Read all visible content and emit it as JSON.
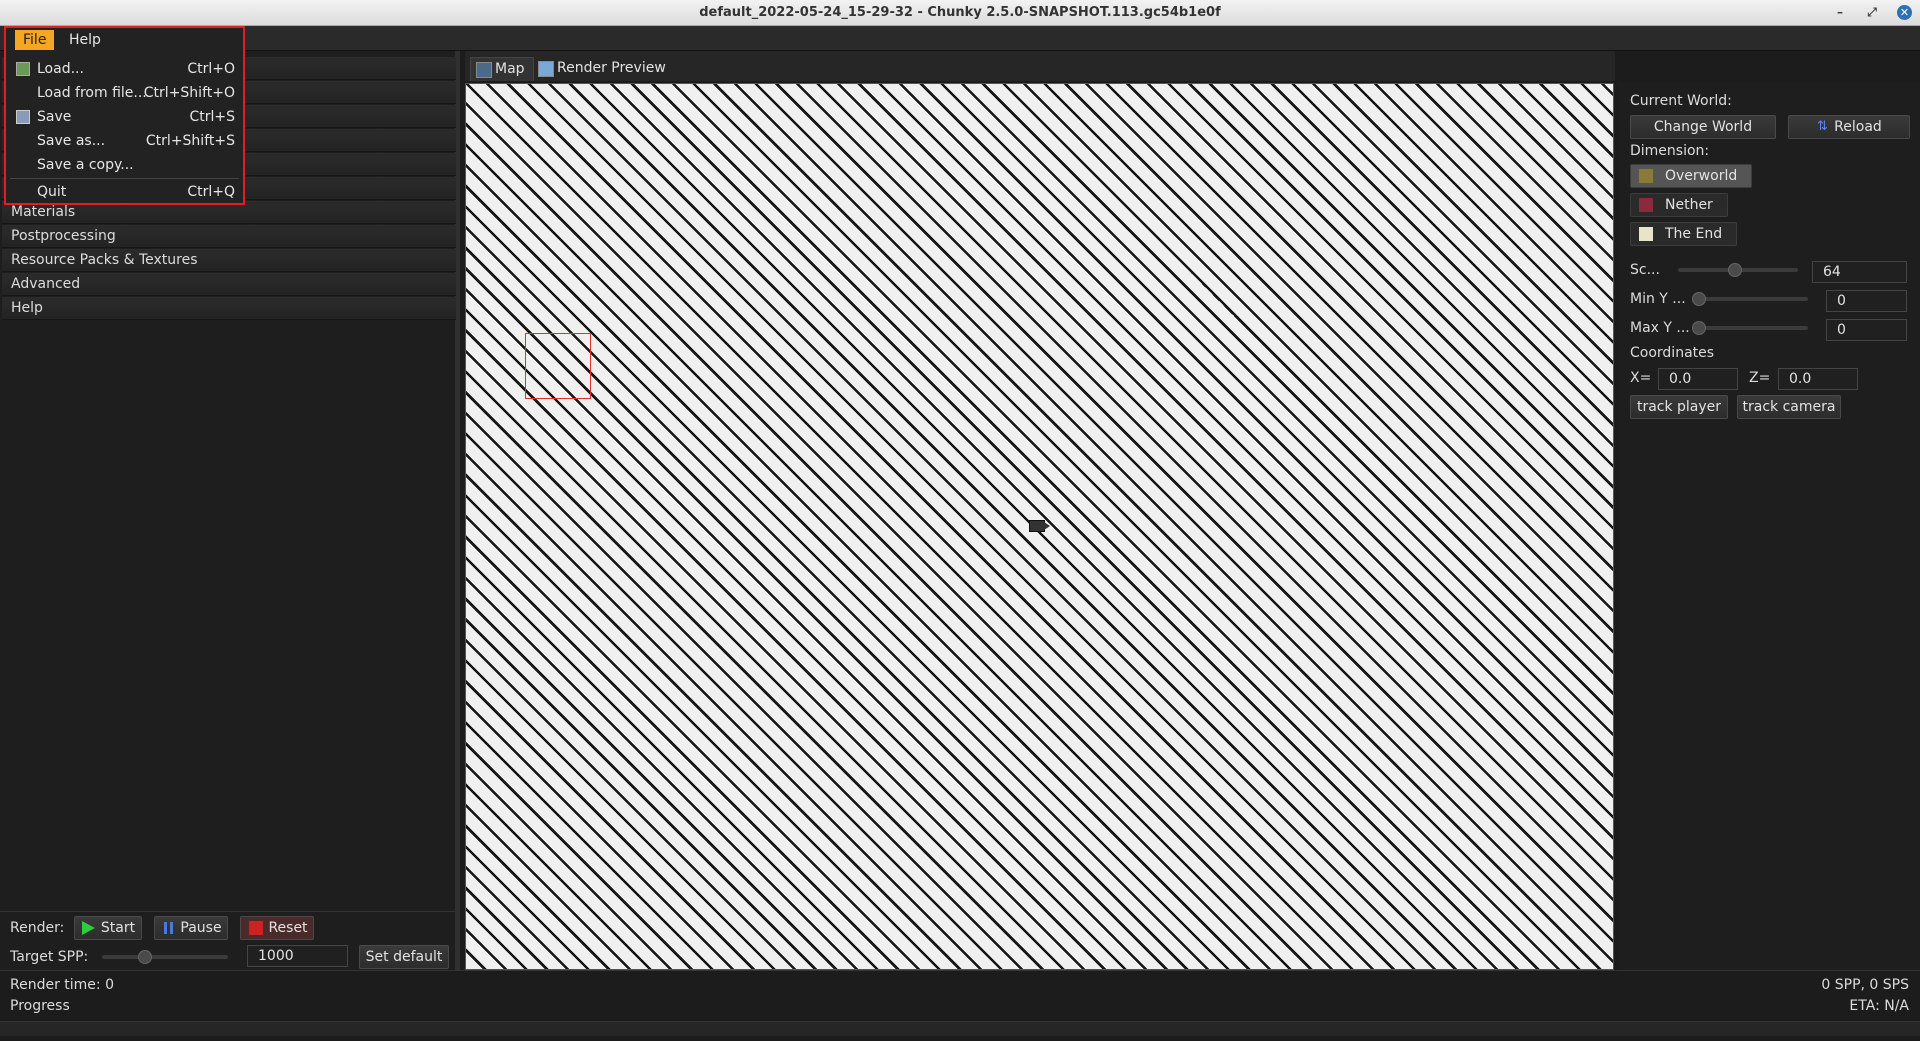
{
  "window": {
    "title": "default_2022-05-24_15-29-32 - Chunky 2.5.0-SNAPSHOT.113.gc54b1e0f",
    "controls": [
      "–",
      "⤢",
      "✕"
    ]
  },
  "menubar": {
    "file": "File",
    "help": "Help"
  },
  "file_menu": {
    "items": [
      {
        "label": "Load...",
        "shortcut": "Ctrl+O",
        "icon": "load-icon"
      },
      {
        "label": "Load from file...",
        "shortcut": "Ctrl+Shift+O",
        "icon": ""
      },
      {
        "label": "Save",
        "shortcut": "Ctrl+S",
        "icon": "save-icon"
      },
      {
        "label": "Save as...",
        "shortcut": "Ctrl+Shift+S",
        "icon": ""
      },
      {
        "label": "Save a copy...",
        "shortcut": "",
        "icon": ""
      },
      {
        "label": "Quit",
        "shortcut": "Ctrl+Q",
        "icon": ""
      }
    ]
  },
  "left_panel": {
    "sections": [
      "Materials",
      "Postprocessing",
      "Resource Packs & Textures",
      "Advanced",
      "Help"
    ]
  },
  "render_controls": {
    "render_label": "Render:",
    "start": "Start",
    "pause": "Pause",
    "reset": "Reset",
    "target_spp_label": "Target SPP:",
    "target_spp_value": "1000",
    "set_default": "Set default",
    "start_color": "#2ecc40",
    "reset_color": "#cc2222"
  },
  "tabs": [
    {
      "label": "Map",
      "active": true
    },
    {
      "label": "Render Preview",
      "active": false
    }
  ],
  "world_panel": {
    "current_world_label": "Current World:",
    "change_world": "Change World",
    "reload": "Reload",
    "dimension_label": "Dimension:",
    "dimensions": [
      {
        "label": "Overworld",
        "active": true,
        "color": "#8a7a3a"
      },
      {
        "label": "Nether",
        "active": false,
        "color": "#8a2a3a"
      },
      {
        "label": "The End",
        "active": false,
        "color": "#e8e4c8"
      }
    ],
    "scale_label": "Sc...",
    "scale_value": "64",
    "min_y_label": "Min Y ...",
    "min_y_value": "0",
    "max_y_label": "Max Y ...",
    "max_y_value": "0",
    "coordinates_label": "Coordinates",
    "x_label": "X=",
    "x_value": "0.0",
    "z_label": "Z=",
    "z_value": "0.0",
    "track_player": "track player",
    "track_camera": "track camera"
  },
  "status": {
    "render_time": "Render time: 0",
    "progress": "Progress",
    "spp": "0 SPP, 0 SPS",
    "eta": "ETA: N/A"
  }
}
